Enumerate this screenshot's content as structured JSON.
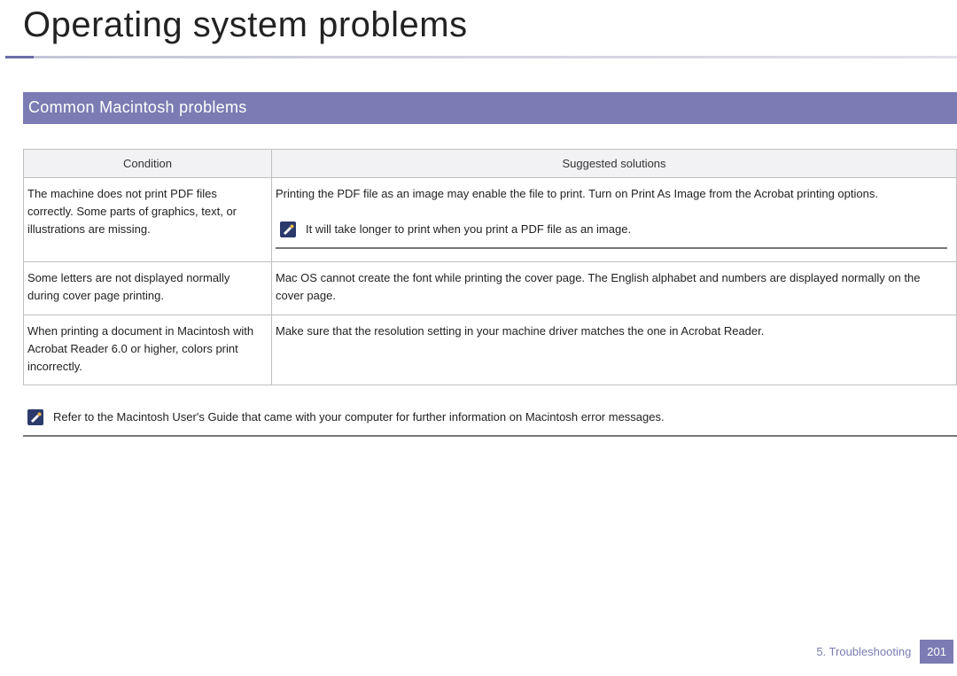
{
  "page": {
    "title": "Operating system problems",
    "section": "Common Macintosh problems"
  },
  "table": {
    "headers": {
      "condition": "Condition",
      "solutions": "Suggested solutions"
    },
    "rows": [
      {
        "condition": "The machine does not print PDF files correctly. Some parts of graphics, text, or illustrations are missing.",
        "solution": "Printing the PDF file as an image may enable the file to print. Turn on Print As Image from the Acrobat printing options.",
        "note": "It will take longer to print when you print a PDF file as an image."
      },
      {
        "condition": "Some letters are not displayed normally during cover page printing.",
        "solution": "Mac OS cannot create the font while printing the cover page. The English alphabet and numbers are displayed normally on the cover page."
      },
      {
        "condition": "When printing a document in Macintosh with Acrobat Reader 6.0 or higher, colors print incorrectly.",
        "solution": "Make sure that the resolution setting in your machine driver matches the one in Acrobat Reader."
      }
    ]
  },
  "bottom_note": "Refer to the Macintosh User's Guide that came with your computer for further information on Macintosh error messages.",
  "footer": {
    "chapter": "5. Troubleshooting",
    "page_number": "201"
  }
}
